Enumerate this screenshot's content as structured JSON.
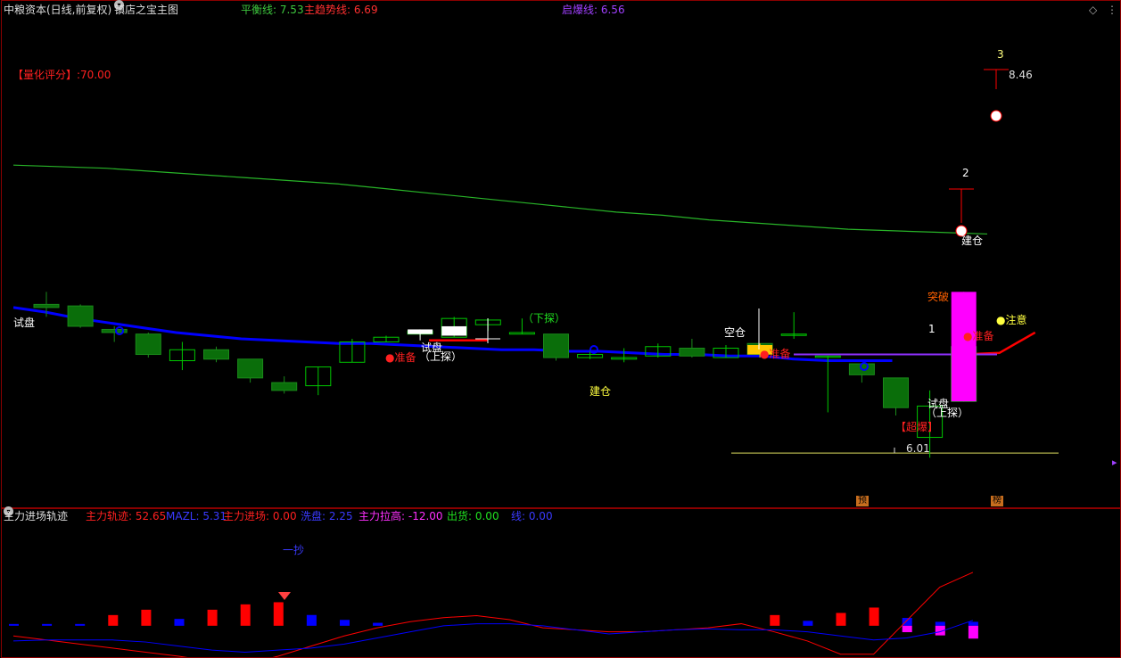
{
  "header": {
    "title": "中粮资本(日线,前复权)",
    "indicator": "镇店之宝主图",
    "balance_label": "平衡线: 7.53",
    "trend_label": "主趋势线: 6.69",
    "breakout_label": "启爆线: 6.56"
  },
  "score_label": "【量化评分】:70.00",
  "annotations": {
    "trial_left": "试盘",
    "trial_mid": "试盘",
    "probe_mid": "（上探）",
    "prepare_1": "●准备",
    "probe_down": "（下探）",
    "build_mid": "建仓",
    "empty_pos": "空仓",
    "prepare_2": "●准备",
    "n3": "3",
    "price_high": "8.46",
    "n2": "2",
    "build_right": "建仓",
    "breakthrough": "突破",
    "n1": "1",
    "prepare_3": "●准备",
    "attention": "●注意",
    "trial_right": "试盘",
    "probe_right": "（上探）",
    "super_burst": "【超爆】",
    "price_low": "6.01",
    "tag_pre": "预",
    "tag_bang": "榜"
  },
  "sub_header": {
    "title": "主力进场轨迹",
    "track": "主力轨迹: 52.65",
    "mazl": "MAZL: 5.31",
    "entry": "主力进场: 0.00",
    "wash": "洗盘: 2.25",
    "pull": "主力拉高: -12.00",
    "ship": "出货: 0.00",
    "line": "线: 0.00"
  },
  "sub_annotation": "一抄",
  "colors": {
    "bull": "#00c800",
    "bear": "#0a6e0a",
    "blue_line": "#0000ff",
    "red": "#ff0000",
    "green_line": "#28b428",
    "magenta": "#ff00ff",
    "yellow": "#ffff00"
  },
  "chart_data": [
    {
      "type": "candlestick",
      "title": "镇店之宝主图",
      "ylim": [
        5.8,
        8.9
      ],
      "candles": [
        {
          "o": 7.08,
          "h": 7.16,
          "l": 7.0,
          "c": 7.06
        },
        {
          "o": 7.07,
          "h": 7.08,
          "l": 6.93,
          "c": 6.94
        },
        {
          "o": 6.92,
          "h": 6.94,
          "l": 6.84,
          "c": 6.9
        },
        {
          "o": 6.89,
          "h": 6.9,
          "l": 6.74,
          "c": 6.76
        },
        {
          "o": 6.72,
          "h": 6.84,
          "l": 6.66,
          "c": 6.79
        },
        {
          "o": 6.79,
          "h": 6.81,
          "l": 6.71,
          "c": 6.73
        },
        {
          "o": 6.73,
          "h": 6.73,
          "l": 6.58,
          "c": 6.61
        },
        {
          "o": 6.58,
          "h": 6.62,
          "l": 6.51,
          "c": 6.53
        },
        {
          "o": 6.56,
          "h": 6.68,
          "l": 6.5,
          "c": 6.68
        },
        {
          "o": 6.71,
          "h": 6.86,
          "l": 6.71,
          "c": 6.84
        },
        {
          "o": 6.84,
          "h": 6.88,
          "l": 6.84,
          "c": 6.87
        },
        {
          "o": 6.89,
          "h": 6.92,
          "l": 6.87,
          "c": 6.91
        },
        {
          "o": 6.87,
          "h": 7.0,
          "l": 6.87,
          "c": 6.99
        },
        {
          "o": 6.95,
          "h": 6.99,
          "l": 6.91,
          "c": 6.98
        },
        {
          "o": 6.89,
          "h": 6.99,
          "l": 6.89,
          "c": 6.9
        },
        {
          "o": 6.89,
          "h": 6.89,
          "l": 6.72,
          "c": 6.74
        },
        {
          "o": 6.74,
          "h": 6.79,
          "l": 6.73,
          "c": 6.76
        },
        {
          "o": 6.73,
          "h": 6.8,
          "l": 6.71,
          "c": 6.74
        },
        {
          "o": 6.75,
          "h": 6.83,
          "l": 6.74,
          "c": 6.81
        },
        {
          "o": 6.8,
          "h": 6.86,
          "l": 6.74,
          "c": 6.75
        },
        {
          "o": 6.74,
          "h": 6.82,
          "l": 6.74,
          "c": 6.8
        },
        {
          "o": 6.83,
          "h": 6.83,
          "l": 6.74,
          "c": 6.76
        },
        {
          "o": 6.89,
          "h": 7.03,
          "l": 6.86,
          "c": 6.89
        },
        {
          "o": 6.75,
          "h": 6.75,
          "l": 6.39,
          "c": 6.75
        },
        {
          "o": 6.7,
          "h": 6.7,
          "l": 6.58,
          "c": 6.63
        },
        {
          "o": 6.61,
          "h": 6.61,
          "l": 6.37,
          "c": 6.42
        },
        {
          "o": 6.23,
          "h": 6.53,
          "l": 6.1,
          "c": 6.43
        },
        {
          "o": 6.46,
          "h": 6.81,
          "l": 6.46,
          "c": 6.81
        }
      ],
      "colored_candles": [
        {
          "index": 11,
          "style": "white",
          "o": 6.89,
          "h": 6.92,
          "l": 6.85,
          "c": 6.92
        },
        {
          "index": 12,
          "style": "white",
          "o": 6.88,
          "h": 6.94,
          "l": 6.88,
          "c": 6.94
        },
        {
          "index": 21,
          "style": "gold",
          "o": 6.76,
          "h": 6.83,
          "l": 6.74,
          "c": 6.82
        },
        {
          "index": 27,
          "style": "magenta",
          "o": 6.46,
          "h": 7.16,
          "l": 6.46,
          "c": 7.16
        }
      ],
      "series": [
        {
          "name": "平衡线",
          "values": [
            7.97,
            7.96,
            7.95,
            7.93,
            7.91,
            7.89,
            7.87,
            7.85,
            7.82,
            7.79,
            7.76,
            7.73,
            7.7,
            7.67,
            7.65,
            7.62,
            7.6,
            7.58,
            7.56,
            7.55,
            7.54,
            7.53
          ]
        },
        {
          "name": "主趋势线",
          "values": [
            7.06,
            7.03,
            6.99,
            6.96,
            6.93,
            6.9,
            6.88,
            6.86,
            6.85,
            6.84,
            6.83,
            6.83,
            6.82,
            6.81,
            6.8,
            6.79,
            6.79,
            6.78,
            6.78,
            6.77,
            6.76,
            6.76,
            6.75,
            6.75,
            6.73,
            6.72,
            6.72,
            6.72
          ]
        }
      ],
      "markers": {
        "low_price": 6.01,
        "high_price": 8.46
      }
    },
    {
      "type": "bar",
      "title": "主力进场轨迹",
      "ylim": [
        -30,
        100
      ],
      "red_bars": [
        {
          "index": 3,
          "value": 10
        },
        {
          "index": 4,
          "value": 15
        },
        {
          "index": 6,
          "value": 15
        },
        {
          "index": 7,
          "value": 20
        },
        {
          "index": 8,
          "value": 22
        },
        {
          "index": 23,
          "value": 10
        },
        {
          "index": 25,
          "value": 12
        },
        {
          "index": 26,
          "value": 17
        }
      ],
      "blue_bars": [
        {
          "index": 0,
          "value": 1
        },
        {
          "index": 1,
          "value": 1
        },
        {
          "index": 2,
          "value": 1
        },
        {
          "index": 5,
          "value": 7
        },
        {
          "index": 9,
          "value": 11
        },
        {
          "index": 10,
          "value": 6
        },
        {
          "index": 11,
          "value": 3
        },
        {
          "index": 24,
          "value": 5
        },
        {
          "index": 27,
          "value": 8
        },
        {
          "index": 28,
          "value": 4
        },
        {
          "index": 29,
          "value": 4
        }
      ],
      "magenta_bars": [
        {
          "index": 27,
          "value": -6
        },
        {
          "index": 28,
          "value": -9
        },
        {
          "index": 29,
          "value": -12
        }
      ],
      "series": [
        {
          "name": "主力轨迹",
          "values": [
            -10,
            -14,
            -18,
            -22,
            -26,
            -30,
            -35,
            -38,
            -30,
            -20,
            -10,
            -2,
            4,
            8,
            10,
            6,
            -2,
            -4,
            -6,
            -6,
            -4,
            -2,
            2,
            -6,
            -15,
            -28,
            -28,
            5,
            38,
            52.65
          ]
        },
        {
          "name": "MAZL",
          "values": [
            -15,
            -14,
            -14,
            -14,
            -16,
            -20,
            -24,
            -26,
            -24,
            -22,
            -18,
            -12,
            -6,
            0,
            2,
            2,
            0,
            -4,
            -8,
            -6,
            -4,
            -3,
            -4,
            -4,
            -6,
            -10,
            -14,
            -12,
            -6,
            5.31
          ]
        }
      ]
    }
  ]
}
